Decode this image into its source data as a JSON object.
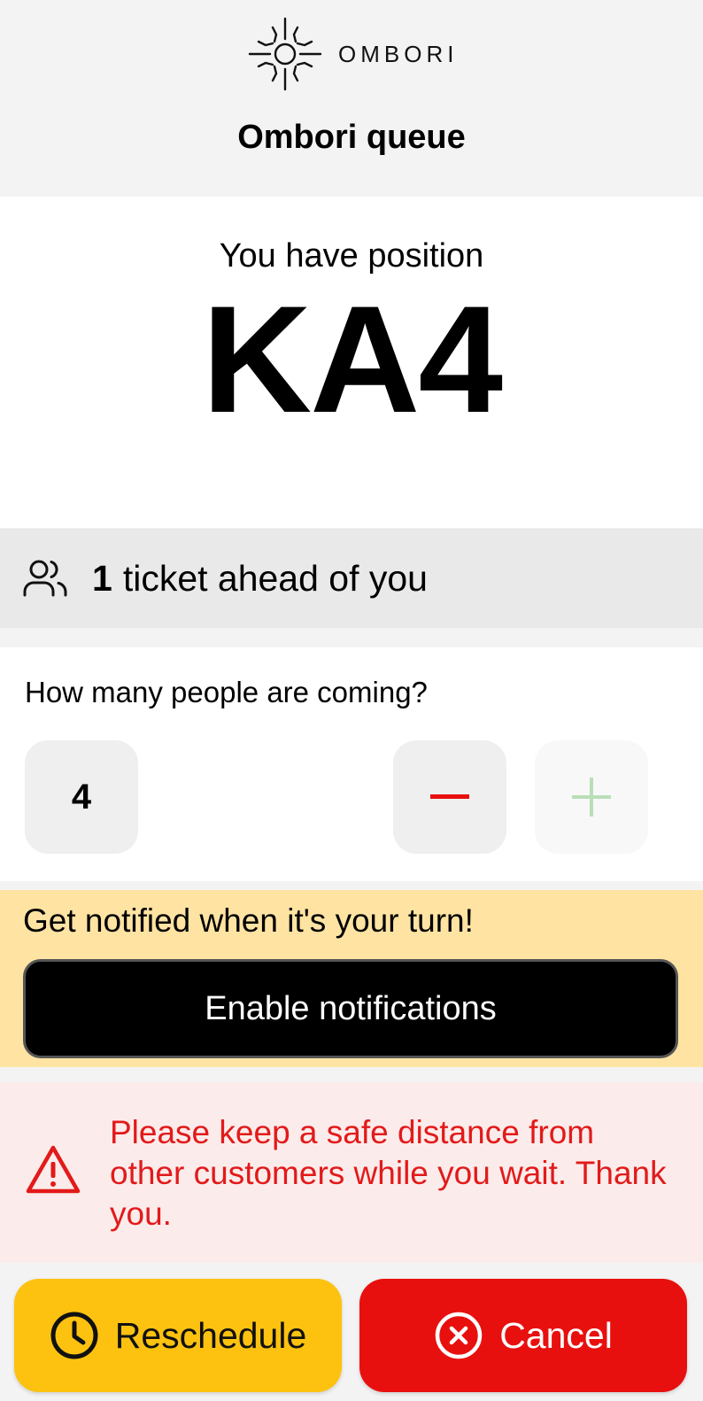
{
  "header": {
    "logo_text": "OMBORI",
    "title": "Ombori queue"
  },
  "position": {
    "label": "You have position",
    "code": "KA4"
  },
  "ahead": {
    "count": "1",
    "text": "ticket ahead of you",
    "icon": "people-icon"
  },
  "party": {
    "question": "How many people are coming?",
    "value": "4",
    "decrement_icon": "minus-icon",
    "increment_icon": "plus-icon"
  },
  "notifications": {
    "prompt": "Get notified when it's your turn!",
    "button_label": "Enable notifications"
  },
  "warning": {
    "message": "Please keep a safe distance from other customers while you wait. Thank you.",
    "icon": "warning-icon"
  },
  "actions": {
    "reschedule_label": "Reschedule",
    "reschedule_icon": "clock-icon",
    "cancel_label": "Cancel",
    "cancel_icon": "close-circle-icon"
  },
  "colors": {
    "accent_yellow": "#fcc20f",
    "danger_red": "#e8100f",
    "warning_text": "#e21a1a",
    "notify_bg": "#ffe3a3",
    "warning_bg": "#fbeceb",
    "plus_disabled": "#b9dfb9"
  }
}
